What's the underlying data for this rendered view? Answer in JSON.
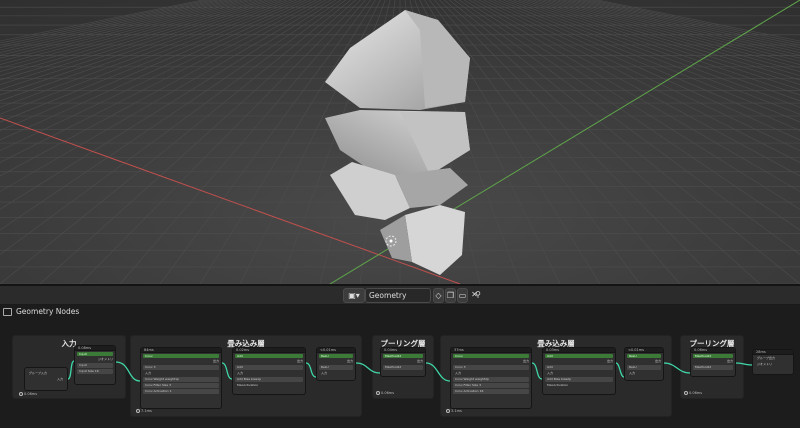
{
  "editor": {
    "name": "Geometry Nodes"
  },
  "header": {
    "node_group_name": "Geometry Nodes",
    "close_glyph": "✕"
  },
  "frames": [
    {
      "label": "入力",
      "time": "0.06ms"
    },
    {
      "label": "畳み込み層",
      "time": "7.1ms"
    },
    {
      "label": "プーリング層",
      "time": "0.06ms"
    },
    {
      "label": "畳み込み層",
      "time": "3.1ms"
    },
    {
      "label": "プーリング層",
      "time": "0.06ms"
    }
  ],
  "nodes": {
    "group_input": {
      "label": "グループ入力",
      "socket": "入力"
    },
    "input": {
      "time": "0.08ms",
      "bar": "Input",
      "out": "ジオメトリ",
      "field": "Input",
      "field2": "Input Size",
      "value": "16"
    },
    "conv1": {
      "time": "84ms",
      "bar": "Conv",
      "out": "出力",
      "field": "Conv",
      "v": "3",
      "in": "入力",
      "r1": "Conv Weight",
      "r2": "Conv Filter Size",
      "r3": "Conv Activation",
      "v1": "weight1p",
      "v2": "3",
      "v3": "1"
    },
    "add1": {
      "time": "0.02ms",
      "bar": "Add",
      "out": "出力",
      "field": "Add",
      "in": "入力",
      "r1": "Add Bias",
      "v1": "bias1p",
      "r2": "MaxActivation"
    },
    "relu1": {
      "time": "<0.01ms",
      "bar": "ReLU",
      "out": "出力",
      "field": "ReLU",
      "in": "入力"
    },
    "pool1": {
      "time": "0.04ms",
      "bar": "MaxPool2d",
      "out": "出力",
      "field": "MaxPool2d",
      "in": "入力"
    },
    "conv2": {
      "time": "37ms",
      "bar": "Conv",
      "out": "出力",
      "field": "Conv",
      "v": "3",
      "in": "入力",
      "r1": "Conv Weight",
      "r2": "Conv Filter Size",
      "r3": "Conv Activation",
      "v1": "weight2p",
      "v2": "3",
      "v3": "16"
    },
    "add2": {
      "time": "0.03ms",
      "bar": "Add",
      "out": "出力",
      "field": "Add",
      "in": "入力",
      "r1": "Add Bias",
      "v1": "bias2p",
      "r2": "MaxActivation"
    },
    "relu2": {
      "time": "<0.01ms",
      "bar": "ReLU",
      "out": "出力",
      "field": "ReLU",
      "in": "入力"
    },
    "pool2": {
      "time": "0.06ms",
      "bar": "MaxPool2d",
      "out": "出力",
      "field": "MaxPool2d",
      "in": "入力"
    },
    "group_output": {
      "time": "28ms",
      "label": "グループ出力",
      "socket": "ジオメトリ"
    }
  },
  "colors": {
    "accent_green": "#3c7a38",
    "link": "#3fd6a8",
    "x_axis": "#c0504d",
    "y_axis": "#5fa64a"
  }
}
